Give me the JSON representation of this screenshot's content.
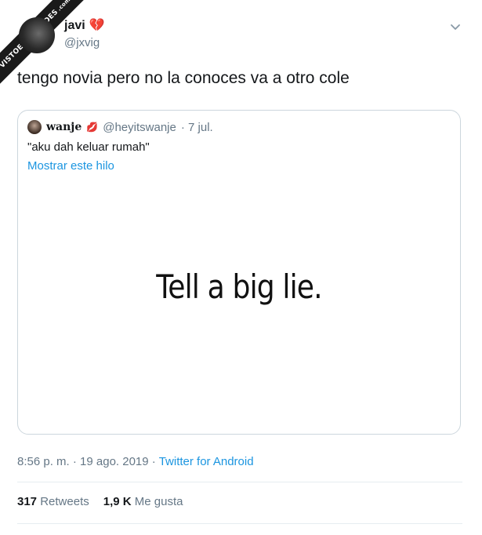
{
  "watermark": {
    "text": "VISTOENLASREDES",
    "suffix": ".com"
  },
  "tweet": {
    "display_name": "javi",
    "name_emoji": "💔",
    "handle": "@jxvig",
    "text": "tengo novia pero no la conoces va a otro cole",
    "timestamp": "8:56 p. m. · 19 ago. 2019",
    "separator": " · ",
    "source": "Twitter for Android"
  },
  "quoted": {
    "display_name": "wanje",
    "name_emoji": "💋",
    "handle": "@heyitswanje",
    "date": "· 7 jul.",
    "text": "\"aku dah keluar rumah\"",
    "thread_link": "Mostrar este hilo",
    "media_text": "Tell a big lie."
  },
  "stats": {
    "retweets_count": "317",
    "retweets_label": "Retweets",
    "likes_count": "1,9 K",
    "likes_label": "Me gusta"
  },
  "icons": {
    "menu": "chevron-down-icon"
  }
}
